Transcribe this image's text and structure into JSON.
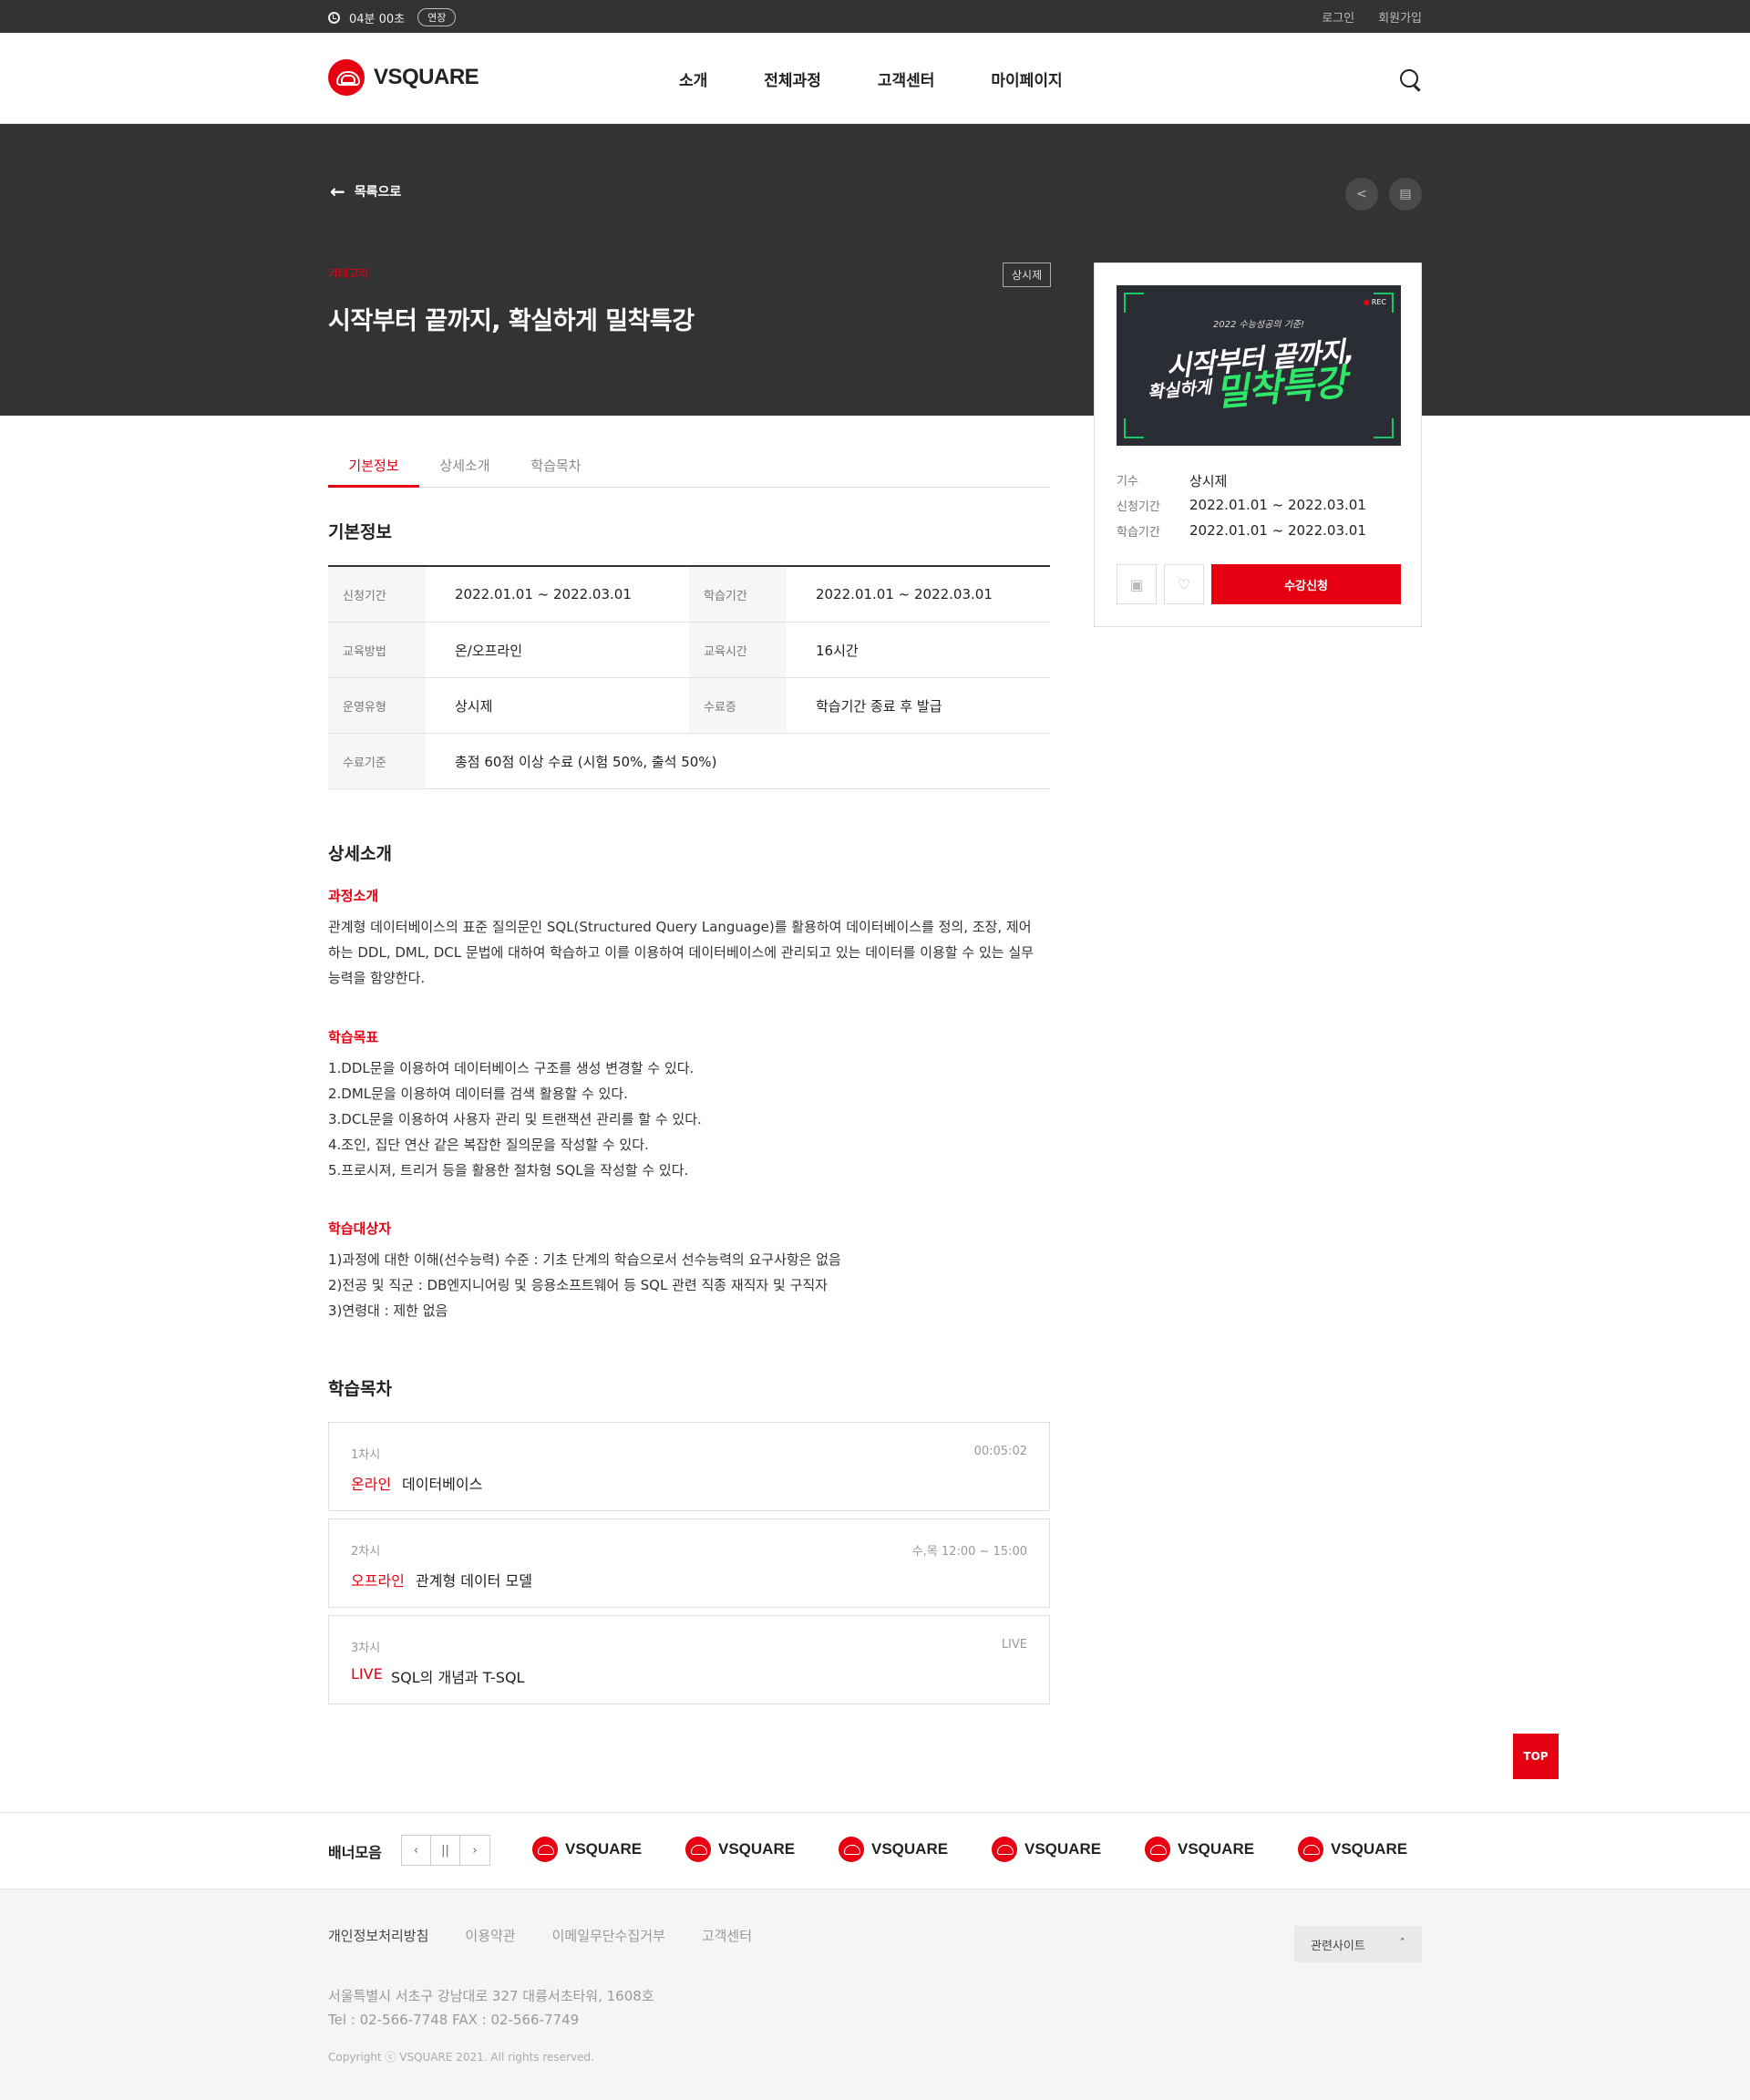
{
  "topbar": {
    "timer": "04분 00초",
    "extend_label": "연장",
    "login": "로그인",
    "signup": "회원가입"
  },
  "header": {
    "logo_text": "VSQUARE",
    "nav": [
      "소개",
      "전체과정",
      "고객센터",
      "마이페이지"
    ]
  },
  "hero": {
    "back_label": "목록으로",
    "category": "카테고리",
    "title": "시작부터 끝까지, 확실하게 밀착특강",
    "badge": "상시제"
  },
  "card": {
    "thumb": {
      "small": "2022 수능성공의 기준!",
      "line1": "시작부터 끝까지,",
      "line2a": "확실하게",
      "line2b": "밀착특강",
      "rec": "REC"
    },
    "rows": [
      {
        "k": "기수",
        "v": "상시제"
      },
      {
        "k": "신청기간",
        "v": "2022.01.01 ~ 2022.03.01"
      },
      {
        "k": "학습기간",
        "v": "2022.01.01 ~ 2022.03.01"
      }
    ],
    "apply_label": "수강신청"
  },
  "tabs": [
    "기본정보",
    "상세소개",
    "학습목차"
  ],
  "basic": {
    "title": "기본정보",
    "rows": [
      {
        "k1": "신청기간",
        "v1": "2022.01.01 ~ 2022.03.01",
        "k2": "학습기간",
        "v2": "2022.01.01 ~ 2022.03.01"
      },
      {
        "k1": "교육방법",
        "v1": "온/오프라인",
        "k2": "교육시간",
        "v2": "16시간"
      },
      {
        "k1": "운영유형",
        "v1": "상시제",
        "k2": "수료증",
        "v2": "학습기간 종료 후 발급"
      },
      {
        "k1": "수료기준",
        "v1": "총점 60점 이상 수료 (시험 50%, 출석 50%)"
      }
    ]
  },
  "detail": {
    "title": "상세소개",
    "intro_title": "과정소개",
    "intro_lines": [
      "관계형 데이터베이스의 표준 질의문인 SQL(Structured Query Language)를 활용하여 데이터베이스를 정의, 조장, 제어",
      "하는 DDL, DML, DCL 문법에 대하여 학습하고 이를 이용하여 데이터베이스에 관리되고 있는 데이터를 이용할 수 있는 실무",
      "능력을 함양한다."
    ],
    "goal_title": "학습목표",
    "goals": [
      "1.DDL문을 이용하여 데이터베이스 구조를 생성 변경할 수 있다.",
      "2.DML문을 이용하여 데이터를 검색 활용할 수 있다.",
      "3.DCL문을 이용하여 사용자 관리 및 트랜잭션 관리를 할 수 있다.",
      "4.조인, 집단 연산 같은 복잡한 질의문을 작성할 수 있다.",
      "5.프로시져, 트리거 등을 활용한 절차형 SQL을 작성할 수 있다."
    ],
    "target_title": "학습대상자",
    "targets": [
      "1)과정에 대한 이해(선수능력) 수준 : 기초 단계의 학습으로서 선수능력의 요구사항은 없음",
      "2)전공 및 직군 : DB엔지니어링 및 응용소프트웨어 등 SQL 관련 직종 재직자 및 구직자",
      "3)연령대 : 제한 없음"
    ]
  },
  "curriculum": {
    "title": "학습목차",
    "items": [
      {
        "num": "1차시",
        "type": "온라인",
        "name": "데이터베이스",
        "meta": "00:05:02"
      },
      {
        "num": "2차시",
        "type": "오프라인",
        "name": "관계형 데이터 모델",
        "meta": "수,목 12:00 ~ 15:00"
      },
      {
        "num": "3차시",
        "type": "LIVE",
        "name": "SQL의 개념과 T-SQL",
        "meta": "LIVE"
      }
    ]
  },
  "top_label": "TOP",
  "banners": {
    "title": "배너모음",
    "logo_text": "VSQUARE"
  },
  "footer": {
    "links": [
      "개인정보처리방침",
      "이용약관",
      "이메일무단수집거부",
      "고객센터"
    ],
    "related": "관련사이트",
    "address": "서울특별시 서초구 강남대로 327 대륭서초타워, 1608호",
    "contact": "Tel : 02-566-7748   FAX : 02-566-7749",
    "copyright": "Copyright ⓒ VSQUARE 2021. All rights reserved."
  },
  "colors": {
    "accent": "#e60012",
    "dark": "#333333",
    "green": "#2ee86a"
  }
}
